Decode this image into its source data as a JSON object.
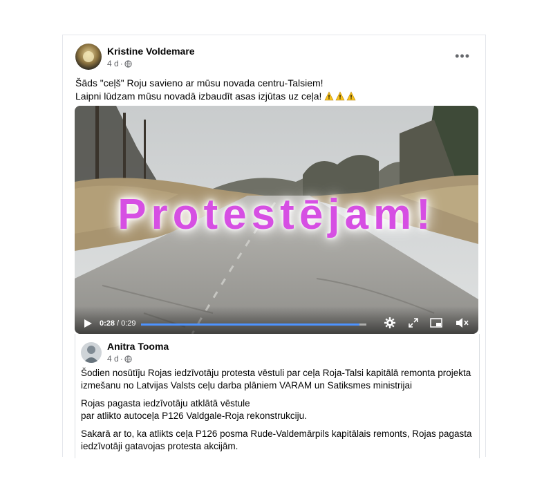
{
  "post": {
    "author": "Kristine Voldemare",
    "time": "4 d",
    "line1": "Šāds \"ceļš\" Roju savieno ar mūsu novada centru-Talsiem!",
    "line2": "Laipni lūdzam mūsu novadā izbaudīt asas izjūtas uz ceļa!",
    "more": "•••"
  },
  "video": {
    "overlay_text": "Protestējam!",
    "current_time": "0:28",
    "duration": "/ 0:29",
    "progress": 0.97
  },
  "shared_post": {
    "author": "Anitra Tooma",
    "time": "4 d",
    "p1a": "Šodien nosūtīju Rojas iedzīvotāju protesta vēstuli par ceļa Roja-Talsi kapitālā remonta projekta",
    "p1b": "izmešanu no Latvijas Valsts ceļu darba plāniem VARAM un Satiksmes ministrijai",
    "p2a": "Rojas pagasta iedzīvotāju atklātā vēstule",
    "p2b": "par atlikto autoceļa P126 Valdgale-Roja rekonstrukciju.",
    "p3a": "Sakarā ar to, ka atlikts ceļa P126 posma Rude-Valdemārpils kapitālais remonts, Rojas pagasta",
    "p3b": "iedzīvotāji gatavojas protesta akcijām."
  },
  "colors": {
    "overlay": "#d64fe3",
    "progress": "#4d93ff"
  },
  "icons": [
    "globe-icon",
    "warning-icon",
    "play-icon",
    "gear-icon",
    "fullscreen-icon",
    "pip-icon",
    "mute-icon"
  ]
}
